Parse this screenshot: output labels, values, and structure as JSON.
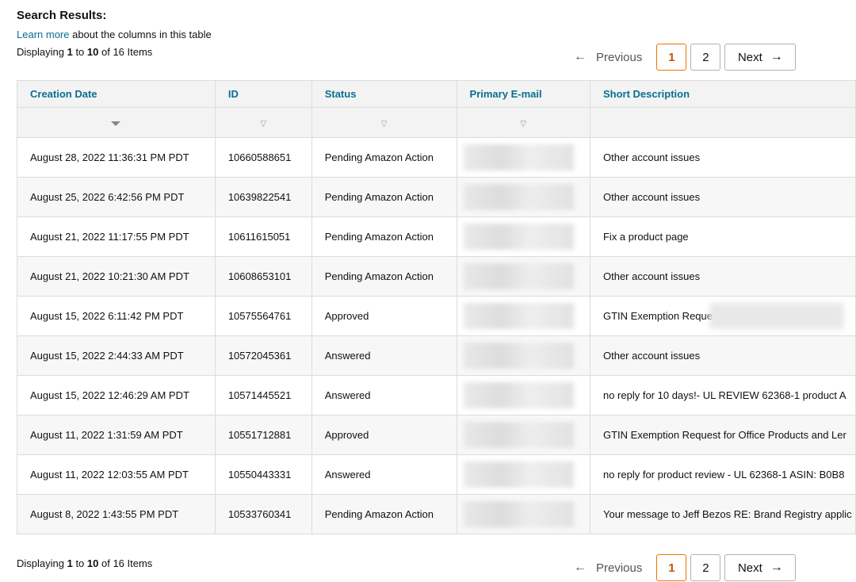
{
  "header": {
    "title": "Search Results:",
    "learn_link": "Learn more",
    "learn_rest": " about the columns in this table"
  },
  "display": {
    "prefix": "Displaying ",
    "from": "1",
    "to_word": " to ",
    "to": "10",
    "of_text": " of 16 Items"
  },
  "pager": {
    "previous": "Previous",
    "page1": "1",
    "page2": "2",
    "next": "Next",
    "left_arrow": "←",
    "right_arrow": "→"
  },
  "table": {
    "columns": [
      "Creation Date",
      "ID",
      "Status",
      "Primary E-mail",
      "Short Description"
    ],
    "rows": [
      {
        "date": "August 28, 2022 11:36:31 PM PDT",
        "id": "10660588651",
        "status": "Pending Amazon Action",
        "description": "Other account issues"
      },
      {
        "date": "August 25, 2022 6:42:56 PM PDT",
        "id": "10639822541",
        "status": "Pending Amazon Action",
        "description": "Other account issues"
      },
      {
        "date": "August 21, 2022 11:17:55 PM PDT",
        "id": "10611615051",
        "status": "Pending Amazon Action",
        "description": "Fix a product page"
      },
      {
        "date": "August 21, 2022 10:21:30 AM PDT",
        "id": "10608653101",
        "status": "Pending Amazon Action",
        "description": "Other account issues"
      },
      {
        "date": "August 15, 2022 6:11:42 PM PDT",
        "id": "10575564761",
        "status": "Approved",
        "description": "GTIN Exemption Reque:"
      },
      {
        "date": "August 15, 2022 2:44:33 AM PDT",
        "id": "10572045361",
        "status": "Answered",
        "description": "Other account issues"
      },
      {
        "date": "August 15, 2022 12:46:29 AM PDT",
        "id": "10571445521",
        "status": "Answered",
        "description": "no reply for 10 days!- UL REVIEW 62368-1 product A"
      },
      {
        "date": "August 11, 2022 1:31:59 AM PDT",
        "id": "10551712881",
        "status": "Approved",
        "description": "GTIN Exemption Request for Office Products and Ler"
      },
      {
        "date": "August 11, 2022 12:03:55 AM PDT",
        "id": "10550443331",
        "status": "Answered",
        "description": "no reply for product review - UL 62368-1 ASIN: B0B8"
      },
      {
        "date": "August 8, 2022 1:43:55 PM PDT",
        "id": "10533760341",
        "status": "Pending Amazon Action",
        "description": "Your message to Jeff Bezos RE: Brand Registry applic"
      }
    ]
  },
  "colors": {
    "link": "#0a6f91",
    "active_page_border": "#e77600",
    "active_page_text": "#c45500",
    "header_bg": "#f3f3f3"
  }
}
